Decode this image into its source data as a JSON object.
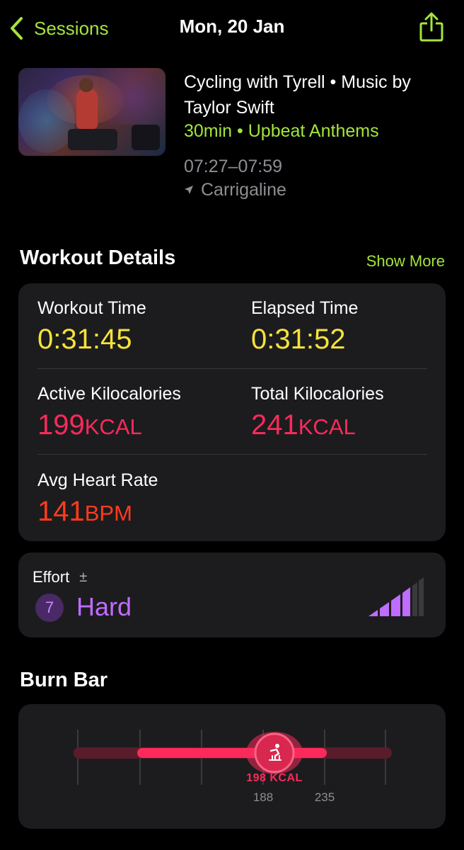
{
  "nav": {
    "back_label": "Sessions",
    "title": "Mon, 20 Jan",
    "share_icon": "share-icon"
  },
  "session": {
    "title": "Cycling with Tyrell • Music by Taylor Swift",
    "subtitle": "30min • Upbeat Anthems",
    "time_range": "07:27–07:59",
    "location": "Carrigaline"
  },
  "details": {
    "title": "Workout Details",
    "show_more": "Show More",
    "metrics": [
      {
        "label": "Workout Time",
        "value": "0:31:45",
        "unit": ""
      },
      {
        "label": "Elapsed Time",
        "value": "0:31:52",
        "unit": ""
      },
      {
        "label": "Active Kilocalories",
        "value": "199",
        "unit": "KCAL"
      },
      {
        "label": "Total Kilocalories",
        "value": "241",
        "unit": "KCAL"
      },
      {
        "label": "Avg Heart Rate",
        "value": "141",
        "unit": "BPM"
      }
    ]
  },
  "effort": {
    "label": "Effort",
    "adjust_symbol": "±",
    "level": "7",
    "text": "Hard",
    "level_fraction": 0.7
  },
  "burn_bar": {
    "title": "Burn Bar",
    "kcal_label": "198 KCAL",
    "range_low": "188",
    "range_high": "235"
  },
  "colors": {
    "accent_green": "#a4e43c",
    "time_yellow": "#f6e23a",
    "kcal_pink": "#fa2a5b",
    "heart_orange": "#ff3b1f",
    "effort_purple": "#bf6cff"
  }
}
